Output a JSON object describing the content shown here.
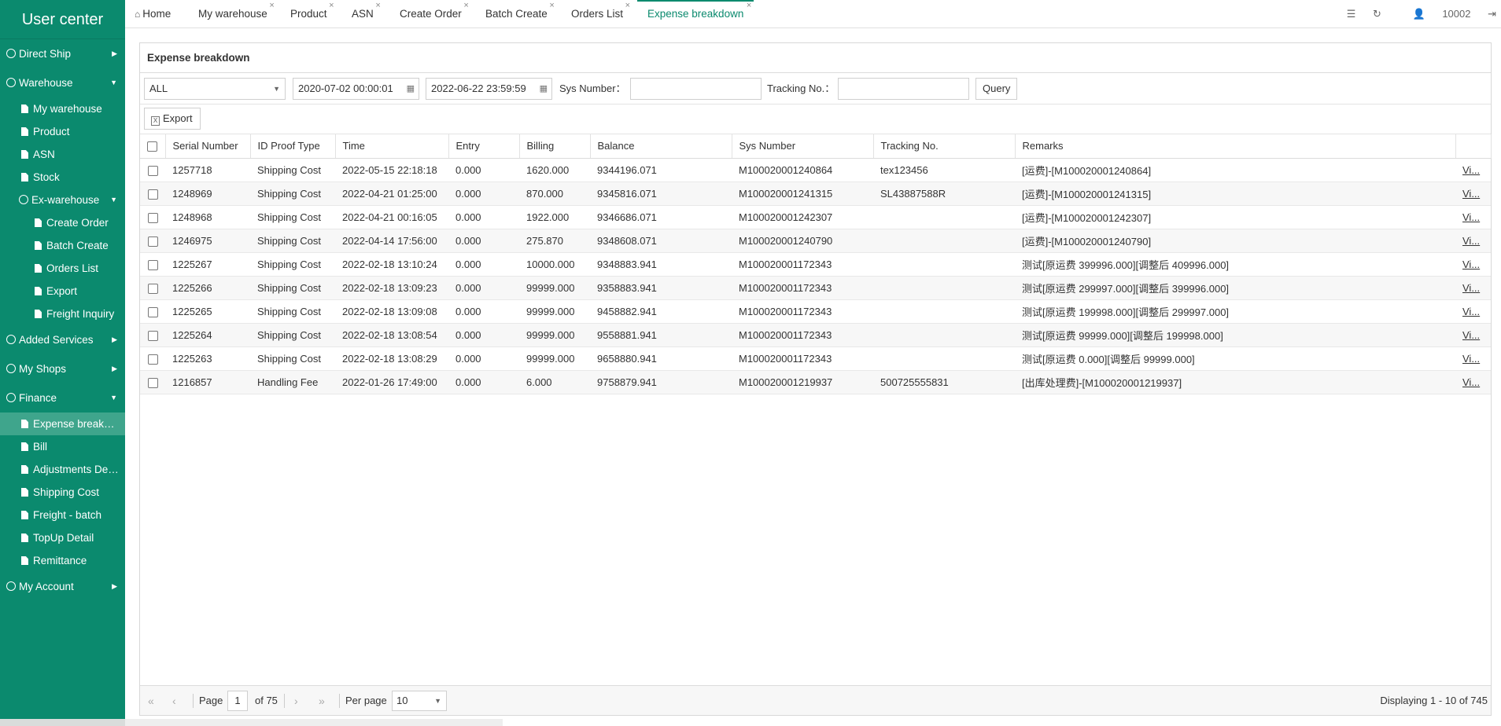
{
  "sidebar": {
    "brand": "User center",
    "direct_ship": "Direct Ship",
    "warehouse": "Warehouse",
    "my_warehouse": "My warehouse",
    "product": "Product",
    "asn": "ASN",
    "stock": "Stock",
    "ex_warehouse": "Ex-warehouse",
    "create_order": "Create Order",
    "batch_create": "Batch Create",
    "orders_list": "Orders List",
    "export": "Export",
    "freight_inquiry": "Freight Inquiry",
    "added_services": "Added Services",
    "my_shops": "My Shops",
    "finance": "Finance",
    "expense_breakdown": "Expense break…",
    "bill": "Bill",
    "adjustments": "Adjustments De…",
    "shipping_cost": "Shipping Cost",
    "freight_batch": "Freight - batch",
    "topup_detail": "TopUp Detail",
    "remittance": "Remittance",
    "my_account": "My Account"
  },
  "tabs": {
    "home": "Home",
    "my_warehouse": "My warehouse",
    "product": "Product",
    "asn": "ASN",
    "create_order": "Create Order",
    "batch_create": "Batch Create",
    "orders_list": "Orders List",
    "expense_breakdown": "Expense breakdown"
  },
  "topright": {
    "user": "10002"
  },
  "panel": {
    "title": "Expense breakdown"
  },
  "filters": {
    "type_value": "ALL",
    "start_date": "2020-07-02 00:00:01",
    "end_date": "2022-06-22 23:59:59",
    "sys_number_label": "Sys Number：",
    "tracking_label": "Tracking No.：",
    "query": "Query"
  },
  "toolbar": {
    "export": "Export"
  },
  "columns": {
    "serial": "Serial Number",
    "id_proof": "ID Proof Type",
    "time": "Time",
    "entry": "Entry",
    "billing": "Billing",
    "balance": "Balance",
    "sys_number": "Sys Number",
    "tracking": "Tracking No.",
    "remarks": "Remarks"
  },
  "rows": [
    {
      "serial": "1257718",
      "type": "Shipping Cost",
      "time": "2022-05-15 22:18:18",
      "entry": "0.000",
      "billing": "1620.000",
      "balance": "9344196.071",
      "sys": "M100020001240864",
      "tracking": "tex123456",
      "remarks": "[运费]-[M100020001240864]",
      "link": "Vi..."
    },
    {
      "serial": "1248969",
      "type": "Shipping Cost",
      "time": "2022-04-21 01:25:00",
      "entry": "0.000",
      "billing": "870.000",
      "balance": "9345816.071",
      "sys": "M100020001241315",
      "tracking": "SL43887588R",
      "remarks": "[运费]-[M100020001241315]",
      "link": "Vi..."
    },
    {
      "serial": "1248968",
      "type": "Shipping Cost",
      "time": "2022-04-21 00:16:05",
      "entry": "0.000",
      "billing": "1922.000",
      "balance": "9346686.071",
      "sys": "M100020001242307",
      "tracking": "",
      "remarks": "[运费]-[M100020001242307]",
      "link": "Vi..."
    },
    {
      "serial": "1246975",
      "type": "Shipping Cost",
      "time": "2022-04-14 17:56:00",
      "entry": "0.000",
      "billing": "275.870",
      "balance": "9348608.071",
      "sys": "M100020001240790",
      "tracking": "",
      "remarks": "[运费]-[M100020001240790]",
      "link": "Vi..."
    },
    {
      "serial": "1225267",
      "type": "Shipping Cost",
      "time": "2022-02-18 13:10:24",
      "entry": "0.000",
      "billing": "10000.000",
      "balance": "9348883.941",
      "sys": "M100020001172343",
      "tracking": "",
      "remarks": "测试[原运费 399996.000][调整后 409996.000]",
      "link": "Vi..."
    },
    {
      "serial": "1225266",
      "type": "Shipping Cost",
      "time": "2022-02-18 13:09:23",
      "entry": "0.000",
      "billing": "99999.000",
      "balance": "9358883.941",
      "sys": "M100020001172343",
      "tracking": "",
      "remarks": "测试[原运费 299997.000][调整后 399996.000]",
      "link": "Vi..."
    },
    {
      "serial": "1225265",
      "type": "Shipping Cost",
      "time": "2022-02-18 13:09:08",
      "entry": "0.000",
      "billing": "99999.000",
      "balance": "9458882.941",
      "sys": "M100020001172343",
      "tracking": "",
      "remarks": "测试[原运费 199998.000][调整后 299997.000]",
      "link": "Vi..."
    },
    {
      "serial": "1225264",
      "type": "Shipping Cost",
      "time": "2022-02-18 13:08:54",
      "entry": "0.000",
      "billing": "99999.000",
      "balance": "9558881.941",
      "sys": "M100020001172343",
      "tracking": "",
      "remarks": "测试[原运费 99999.000][调整后 199998.000]",
      "link": "Vi..."
    },
    {
      "serial": "1225263",
      "type": "Shipping Cost",
      "time": "2022-02-18 13:08:29",
      "entry": "0.000",
      "billing": "99999.000",
      "balance": "9658880.941",
      "sys": "M100020001172343",
      "tracking": "",
      "remarks": "测试[原运费 0.000][调整后 99999.000]",
      "link": "Vi..."
    },
    {
      "serial": "1216857",
      "type": "Handling Fee",
      "time": "2022-01-26 17:49:00",
      "entry": "0.000",
      "billing": "6.000",
      "balance": "9758879.941",
      "sys": "M100020001219937",
      "tracking": "500725555831",
      "remarks": "[出库处理费]-[M100020001219937]",
      "link": "Vi..."
    }
  ],
  "pager": {
    "page_label": "Page",
    "page_value": "1",
    "of_label": "of 75",
    "per_page_label": "Per page",
    "per_page_value": "10",
    "displaying": "Displaying 1 - 10 of 745"
  },
  "colors": {
    "sidebar_bg": "#0b8a6e",
    "active_item": "#3fa58c",
    "accent": "#0b8a6e"
  }
}
